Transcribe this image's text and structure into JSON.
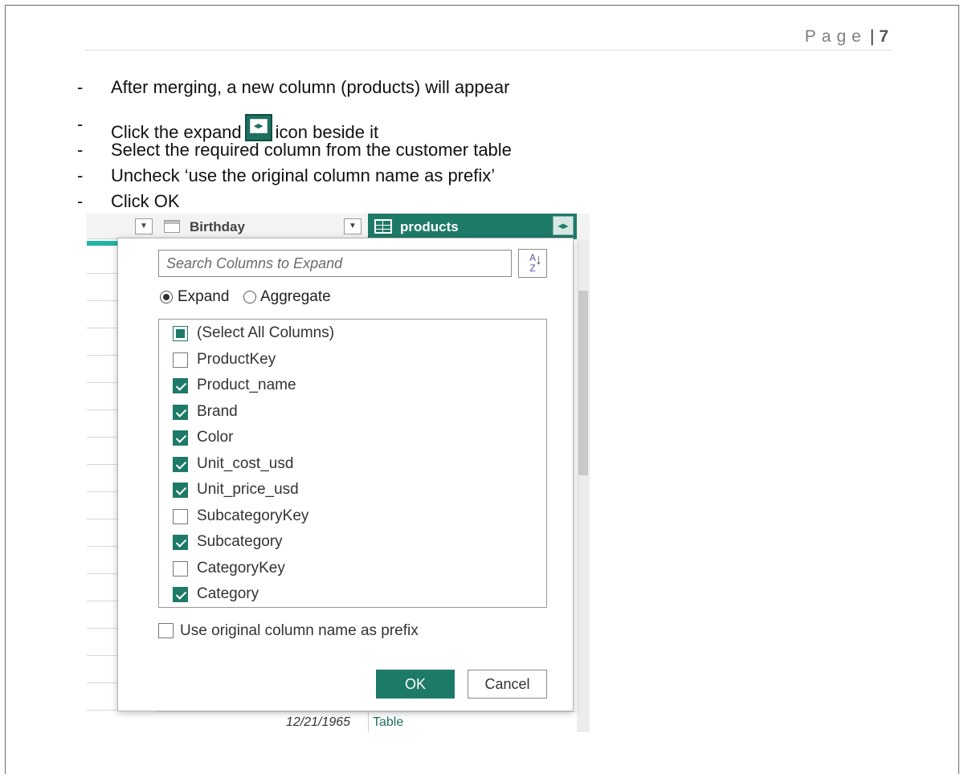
{
  "header": {
    "page_word": "Page",
    "page_number": "7"
  },
  "bullets": [
    {
      "dash": "-",
      "text": "After merging, a new column (products) will appear"
    },
    {
      "dash": "-",
      "text_before": "Click the expand",
      "text_after": "icon beside it"
    },
    {
      "dash": "-",
      "text": "Select the required column from the customer table"
    },
    {
      "dash": "-",
      "text": "Uncheck ‘use the original column name as prefix’"
    },
    {
      "dash": "-",
      "text": "Click OK"
    }
  ],
  "screenshot": {
    "columns": {
      "birthday_label": "Birthday",
      "products_label": "products"
    },
    "dialog": {
      "search_placeholder": "Search Columns to Expand",
      "sort_icon": "sort-az-icon",
      "radio_expand": "Expand",
      "radio_aggregate": "Aggregate",
      "selected_mode": "Expand",
      "items": [
        {
          "label": "(Select All Columns)",
          "state": "partial"
        },
        {
          "label": "ProductKey",
          "state": "unchecked"
        },
        {
          "label": "Product_name",
          "state": "checked"
        },
        {
          "label": "Brand",
          "state": "checked"
        },
        {
          "label": "Color",
          "state": "checked"
        },
        {
          "label": "Unit_cost_usd",
          "state": "checked"
        },
        {
          "label": "Unit_price_usd",
          "state": "checked"
        },
        {
          "label": "SubcategoryKey",
          "state": "unchecked"
        },
        {
          "label": "Subcategory",
          "state": "checked"
        },
        {
          "label": "CategoryKey",
          "state": "unchecked"
        },
        {
          "label": "Category",
          "state": "checked"
        }
      ],
      "prefix_label": "Use original column name as prefix",
      "prefix_checked": false,
      "ok_label": "OK",
      "cancel_label": "Cancel"
    },
    "footer": {
      "date": "12/21/1965",
      "table": "Table"
    },
    "accent_color": "#1e7a68"
  }
}
